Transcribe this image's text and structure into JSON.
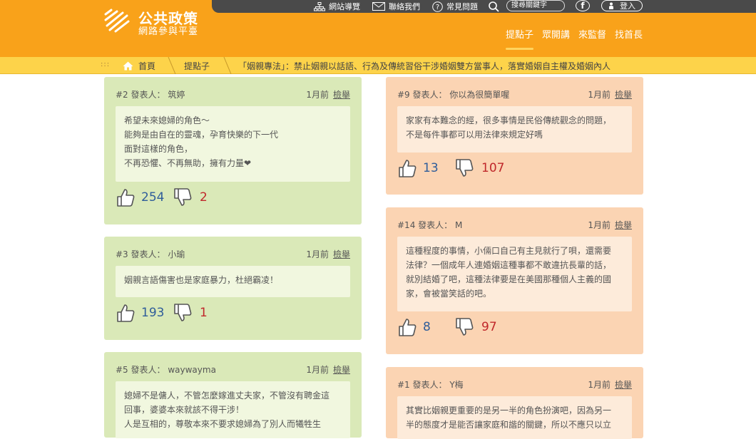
{
  "topbar": {
    "sitemap": "網站導覽",
    "contact": "聯絡我們",
    "faq": "常見問題",
    "search_placeholder": "搜尋關鍵字",
    "facebook": "f",
    "login": "登入"
  },
  "logo": {
    "title": "公共政策",
    "subtitle": "網路參與平臺"
  },
  "nav": [
    "提點子",
    "眾開講",
    "來監督",
    "找首長"
  ],
  "breadcrumb": {
    "home": "首頁",
    "section": "提點子",
    "current": "「姻親專法」：禁止姻親以話語、行為及傳統習俗干涉婚姻雙方當事人，落實婚姻自主權及婚姻內人"
  },
  "report_label": "檢舉",
  "comments": [
    {
      "num": "#2",
      "author": "發表人： 筑婷",
      "time": "1月前",
      "lines": [
        "希望未來媳婦的角色～",
        "能夠是由自在的靈魂，孕育快樂的下一代",
        "面對這樣的角色，",
        "不再恐懼、不再無助，擁有力量❤"
      ],
      "up": "254",
      "down": "2"
    },
    {
      "num": "#3",
      "author": "發表人： 小瑜",
      "time": "1月前",
      "lines": [
        "姻親言語傷害也是家庭暴力，杜絕霸凌！"
      ],
      "up": "193",
      "down": "1"
    },
    {
      "num": "#5",
      "author": "發表人： waywayma",
      "time": "1月前",
      "lines": [
        "媳婦不是傭人，不管怎麼嫁進丈夫家，不管沒有聘金這",
        "回事，婆婆本來就該不得干涉！",
        "人是互相的，尊敬本來不要求媳婦為了別人而犧牲生"
      ],
      "up": "",
      "down": ""
    },
    {
      "num": "#9",
      "author": "發表人： 你以為很簡單喔",
      "time": "1月前",
      "lines": [
        "家家有本難念的經，很多事情是民俗傳統觀念的問題，",
        "不是每件事都可以用法律來規定好嗎"
      ],
      "up": "13",
      "down": "107"
    },
    {
      "num": "#14",
      "author": "發表人： M",
      "time": "1月前",
      "lines": [
        "這種程度的事情，小倆口自己有主見就行了唄，還需要",
        "法律？一個成年人連婚姻這種事都不敢違抗長輩的話，",
        "就別結婚了吧，這種法律要是在美國那種個人主義的國",
        "家，會被當笑話的吧。"
      ],
      "up": "8",
      "down": "97"
    },
    {
      "num": "#1",
      "author": "發表人： Y梅",
      "time": "1月前",
      "lines": [
        "其實比姻親更重要的是另一半的角色扮演吧，因為另一",
        "半的態度才是能否讓家庭和諧的關鍵，所以不應只以立"
      ],
      "up": "",
      "down": ""
    }
  ],
  "colors": {
    "header": "#f9a21a",
    "breadcrumb": "#fdd34a",
    "topbar": "#4a4a4a",
    "card_green": "#dae9b8",
    "card_orange": "#fbd4b3",
    "up_count": "#2f5d9a",
    "down_count": "#c0282b"
  },
  "icons": [
    "sitemap-icon",
    "mail-icon",
    "question-icon",
    "search-icon",
    "facebook-icon",
    "user-icon",
    "home-icon",
    "thumbs-up-icon",
    "thumbs-down-icon"
  ]
}
